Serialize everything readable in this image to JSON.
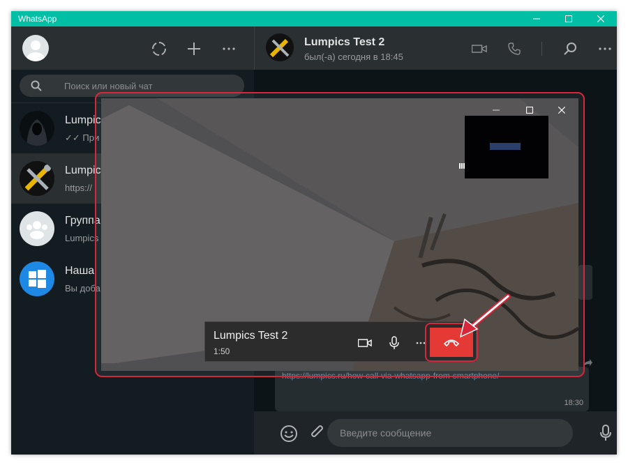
{
  "window": {
    "title": "WhatsApp"
  },
  "sidebar": {
    "search": {
      "placeholder": "Поиск или новый чат"
    },
    "chats": [
      {
        "name": "Lumpics",
        "preview": "✓✓ При"
      },
      {
        "name": "Lumpic",
        "preview": "https://"
      },
      {
        "name": "Группа",
        "preview": "Lumpics"
      },
      {
        "name": "Наша",
        "preview": "Вы доба"
      }
    ]
  },
  "conversation": {
    "contact_name": "Lumpics Test 2",
    "contact_status": "был(-а) сегодня в 18:45",
    "message": {
      "text": "https://lumpics.ru/how-call-via-whatsapp-from-smartphone/",
      "time": "18:30"
    },
    "compose_placeholder": "Введите сообщение"
  },
  "call": {
    "contact_name": "Lumpics Test 2",
    "duration": "1:50"
  },
  "colors": {
    "titlebar": "#00bfa5",
    "hangup": "#e53935",
    "annotation": "#d8263a"
  },
  "icons": [
    "status-icon",
    "new-chat-icon",
    "menu-icon",
    "search-icon",
    "video-call-icon",
    "voice-call-icon",
    "microphone-icon",
    "emoji-icon",
    "attach-icon",
    "hangup-icon"
  ]
}
